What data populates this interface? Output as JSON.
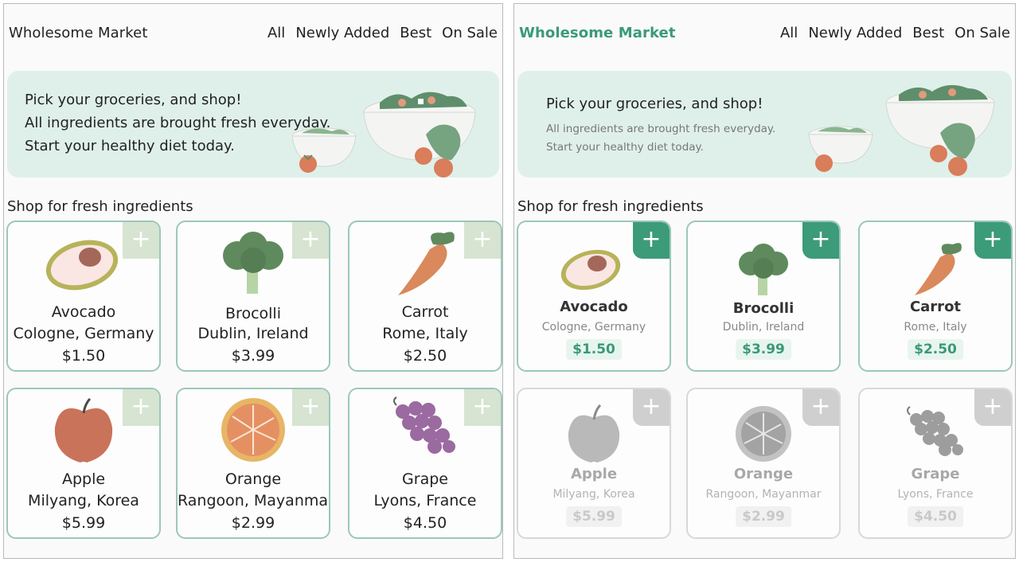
{
  "panels": [
    {
      "brand": "Wholesome Market",
      "menu": [
        "All",
        "Newly Added",
        "Best",
        "On Sale"
      ],
      "banner": [
        "Pick your groceries, and shop!",
        "All ingredients are brought fresh everyday.",
        "Start your healthy diet today."
      ],
      "section_title": "Shop for fresh ingredients",
      "products": [
        {
          "name": "Avocado",
          "origin": "Cologne, Germany",
          "price": "$1.50",
          "icon": "avocado-icon"
        },
        {
          "name": "Brocolli",
          "origin": "Dublin, Ireland",
          "price": "$3.99",
          "icon": "broccoli-icon"
        },
        {
          "name": "Carrot",
          "origin": "Rome, Italy",
          "price": "$2.50",
          "icon": "carrot-icon"
        },
        {
          "name": "Apple",
          "origin": "Milyang, Korea",
          "price": "$5.99",
          "icon": "apple-icon"
        },
        {
          "name": "Orange",
          "origin": "Rangoon, Mayanmar",
          "price": "$2.99",
          "icon": "orange-icon"
        },
        {
          "name": "Grape",
          "origin": "Lyons, France",
          "price": "$4.50",
          "icon": "grape-icon"
        }
      ]
    },
    {
      "brand": "Wholesome Market",
      "menu": [
        "All",
        "Newly Added",
        "Best",
        "On Sale"
      ],
      "banner": [
        "Pick your groceries, and shop!",
        "All ingredients are brought fresh everyday.",
        "Start your healthy diet today."
      ],
      "section_title": "Shop for fresh ingredients",
      "products": [
        {
          "name": "Avocado",
          "origin": "Cologne, Germany",
          "price": "$1.50",
          "icon": "avocado-icon"
        },
        {
          "name": "Brocolli",
          "origin": "Dublin, Ireland",
          "price": "$3.99",
          "icon": "broccoli-icon"
        },
        {
          "name": "Carrot",
          "origin": "Rome, Italy",
          "price": "$2.50",
          "icon": "carrot-icon"
        },
        {
          "name": "Apple",
          "origin": "Milyang, Korea",
          "price": "$5.99",
          "icon": "apple-icon"
        },
        {
          "name": "Orange",
          "origin": "Rangoon, Mayanmar",
          "price": "$2.99",
          "icon": "orange-icon"
        },
        {
          "name": "Grape",
          "origin": "Lyons, France",
          "price": "$4.50",
          "icon": "grape-icon"
        }
      ]
    }
  ],
  "add_symbol": "+",
  "colors": {
    "accent": "#3a9a78",
    "banner_bg": "#dff0ea",
    "card_border": "#9cc7ba",
    "plus_light": "#d6e4d1",
    "disabled": "#cfcfcf"
  }
}
